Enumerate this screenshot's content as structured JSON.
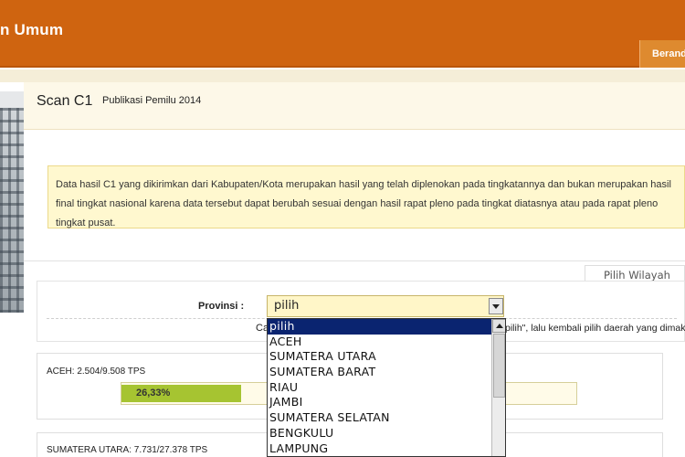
{
  "header": {
    "brand": "n Umum",
    "nav_home": "Berand"
  },
  "page": {
    "title": "Scan C1",
    "subtitle": "Publikasi Pemilu 2014"
  },
  "notice": {
    "text": "Data hasil C1 yang dikirimkan dari Kabupaten/Kota merupakan hasil yang telah diplenokan pada tingkatannya dan bukan merupakan hasil final tingkat nasional karena data tersebut dapat berubah sesuai dengan hasil rapat pleno pada tingkat diatasnya atau pada rapat pleno tingkat pusat."
  },
  "filter": {
    "region_tab": "Pilih Wilayah",
    "provinsi_label": "Provinsi :",
    "selected": "pilih",
    "hint_left": "Ca",
    "hint_right": "pilih\", lalu kembali pilih daerah yang dimaks",
    "options": [
      "pilih",
      "ACEH",
      "SUMATERA UTARA",
      "SUMATERA BARAT",
      "RIAU",
      "JAMBI",
      "SUMATERA SELATAN",
      "BENGKULU",
      "LAMPUNG"
    ]
  },
  "progress": [
    {
      "label": "ACEH: 2.504/9.508 TPS",
      "percent_text": "26,33%",
      "percent": 26.33
    },
    {
      "label": "SUMATERA UTARA: 7.731/27.378 TPS"
    }
  ],
  "colors": {
    "header_bg": "#cf6410",
    "notice_bg": "#fff8cf",
    "select_bg": "#fff6c8",
    "progress_fill": "#a6c431",
    "dropdown_selected": "#0a2470"
  }
}
